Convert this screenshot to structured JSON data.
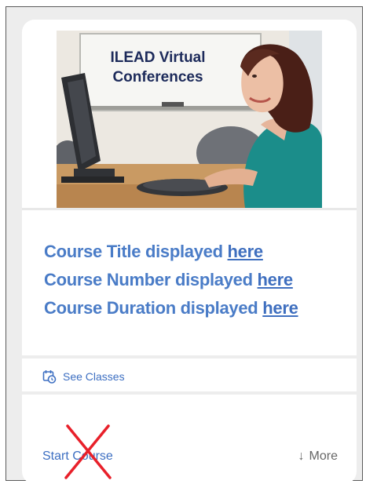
{
  "hero": {
    "caption_line1": "ILEAD Virtual",
    "caption_line2": "Conferences"
  },
  "course": {
    "title_label": "Course Title displayed",
    "number_label": "Course Number displayed",
    "duration_label": "Course Duration displayed",
    "link_text": "here"
  },
  "actions": {
    "see_classes": "See Classes",
    "start_course": "Start Course",
    "more": "More",
    "more_arrow": "↓"
  },
  "colors": {
    "link_blue": "#3d6fc2",
    "title_blue": "#4a7cc7",
    "cross_red": "#e8202a"
  }
}
